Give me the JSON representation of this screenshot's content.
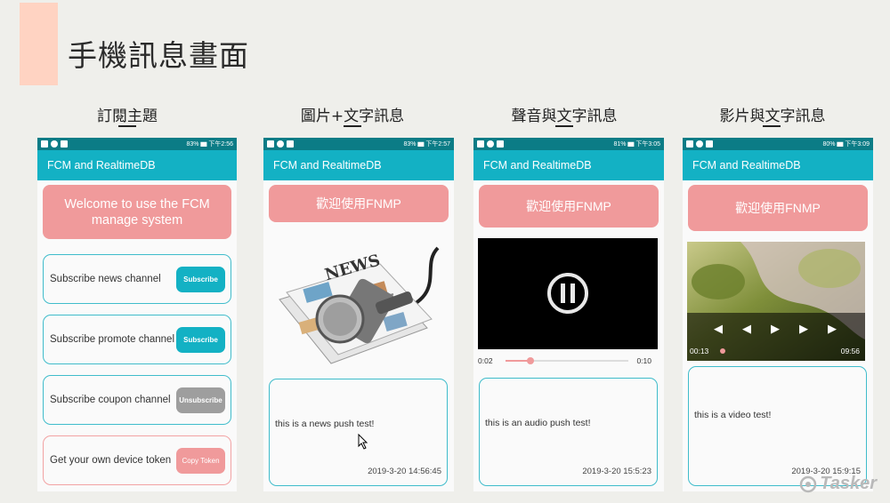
{
  "slide_title": "手機訊息畫面",
  "columns": [
    {
      "heading": "訂閱主題"
    },
    {
      "heading": "圖片+文字訊息"
    },
    {
      "heading": "聲音與文字訊息"
    },
    {
      "heading": "影片與文字訊息"
    }
  ],
  "phones": [
    {
      "status": "83% ▆ 下午2:56"
    },
    {
      "status": "83% ▆ 下午2:57"
    },
    {
      "status": "81% ▆ 下午3:05"
    },
    {
      "status": "80% ▆ 下午3:09"
    }
  ],
  "app_title": "FCM and RealtimeDB",
  "phone1": {
    "welcome": "Welcome to use the FCM manage system",
    "rows": [
      {
        "label": "Subscribe news channel",
        "button": "Subscribe"
      },
      {
        "label": "Subscribe promote channel",
        "button": "Subscribe"
      },
      {
        "label": "Subscribe coupon channel",
        "button": "Unsubscribe"
      },
      {
        "label": "Get your own device token",
        "button": "Copy Token"
      }
    ]
  },
  "welcome_zh": "歡迎使用FNMP",
  "phone2": {
    "image_text": "NEWS",
    "message": "this is a news push test!",
    "time": "2019-3-20 14:56:45"
  },
  "phone3": {
    "elapsed": "0:02",
    "duration": "0:10",
    "progress": 0.2,
    "message": "this is an audio push test!",
    "time": "2019-3-20 15:5:23"
  },
  "phone4": {
    "elapsed": "00:13",
    "duration": "09:56",
    "message": "this is a video test!",
    "time": "2019-3-20 15:9:15"
  },
  "watermark": "Tasker"
}
